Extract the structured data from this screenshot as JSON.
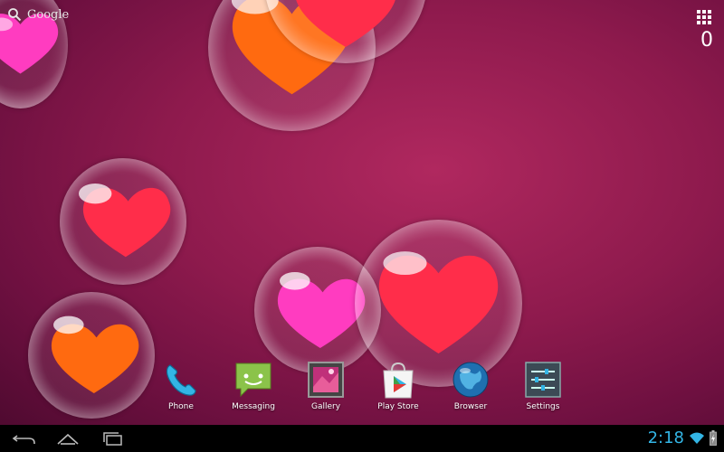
{
  "home": {
    "search_label": "Google",
    "counter": "0"
  },
  "dock": {
    "items": [
      {
        "label": "Phone",
        "icon": "phone-icon"
      },
      {
        "label": "Messaging",
        "icon": "messaging-icon"
      },
      {
        "label": "Gallery",
        "icon": "gallery-icon"
      },
      {
        "label": "Play Store",
        "icon": "play-store-icon"
      },
      {
        "label": "Browser",
        "icon": "browser-icon"
      },
      {
        "label": "Settings",
        "icon": "settings-icon"
      }
    ]
  },
  "statusbar": {
    "time": "2:18",
    "clock_color": "#33b5e5"
  },
  "colors": {
    "wallpaper": "#9a1f55",
    "heart_red": "#ff2d4a",
    "heart_pink": "#ff3cc0",
    "heart_orange": "#ff6a10"
  }
}
